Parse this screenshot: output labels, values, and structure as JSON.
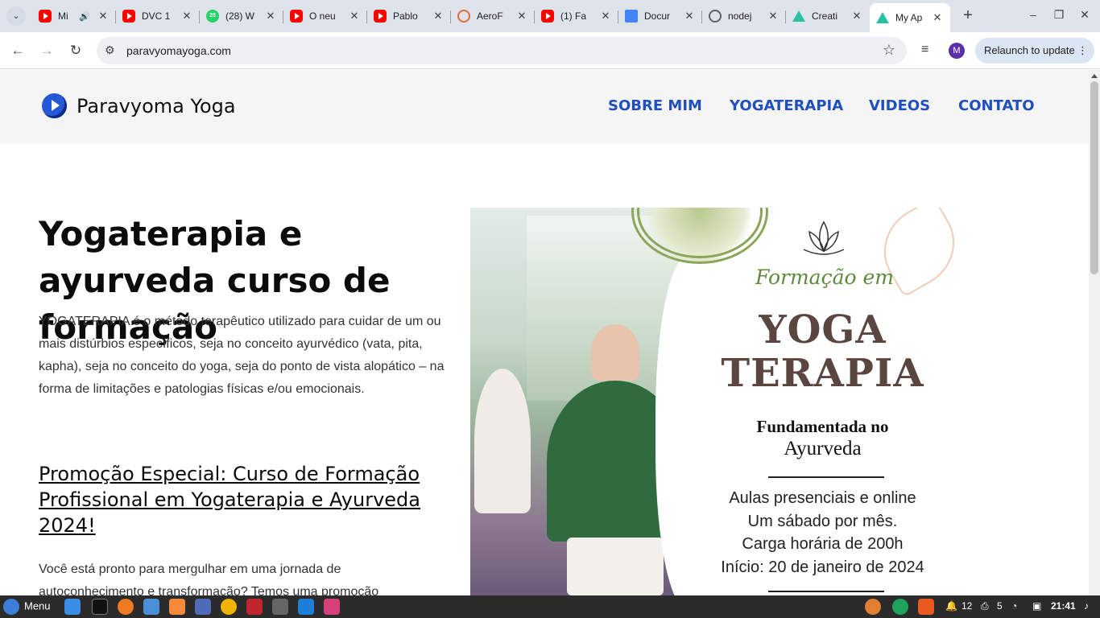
{
  "browser": {
    "tabs": [
      {
        "title": "Mi",
        "favicon": "youtube-icon"
      },
      {
        "title": "DVC 1",
        "favicon": "youtube-icon"
      },
      {
        "title": "(28) W",
        "favicon": "whatsapp-icon",
        "badge": "28"
      },
      {
        "title": "O neu",
        "favicon": "youtube-icon"
      },
      {
        "title": "Pablo",
        "favicon": "youtube-icon"
      },
      {
        "title": "AeroF",
        "favicon": "aero-icon"
      },
      {
        "title": "(1) Fa",
        "favicon": "youtube-icon"
      },
      {
        "title": "Docur",
        "favicon": "docs-icon"
      },
      {
        "title": "nodej",
        "favicon": "globe-icon"
      },
      {
        "title": "Creati",
        "favicon": "triangle-icon"
      },
      {
        "title": "My Ap",
        "favicon": "triangle-icon",
        "active": true
      }
    ],
    "url": "paravyomayoga.com",
    "profile_initial": "M",
    "relaunch_label": "Relaunch to update"
  },
  "site": {
    "brand": "Paravyoma Yoga",
    "nav": [
      "SOBRE MIM",
      "YOGATERAPIA",
      "VIDEOS",
      "CONTATO"
    ],
    "hero_title": "Yogaterapia e ayurveda curso de formação",
    "hero_desc": "YOGATERAPIA é o método terapêutico utilizado para cuidar de um ou mais distúrbios específicos, seja no conceito ayurvédico (vata, pita, kapha), seja no conceito do yoga, seja do ponto de vista alopático – na forma de limitações e patologias físicas e/ou emocionais.",
    "promo_link": "Promoção Especial: Curso de Formação Profissional em Yogaterapia e Ayurveda 2024!",
    "promo_text": "Você está pronto para mergulhar em uma jornada de autoconhecimento e transformação? Temos uma promoção"
  },
  "poster": {
    "formacao": "Formação em",
    "yoga": "YOGA",
    "terapia": "TERAPIA",
    "fundamentada": "Fundamentada no",
    "ayurveda": "Ayurveda",
    "lines": [
      "Aulas presenciais e online",
      "Um sábado por mês.",
      "Carga horária de 200h",
      "Início: 20 de janeiro de 2024"
    ]
  },
  "taskbar": {
    "menu_label": "Menu",
    "notifications": "12",
    "printers": "5",
    "time": "21:41"
  },
  "colors": {
    "nav_link": "#1f4fc1",
    "poster_green": "#5f8a3c",
    "poster_brown": "#5a4540"
  }
}
